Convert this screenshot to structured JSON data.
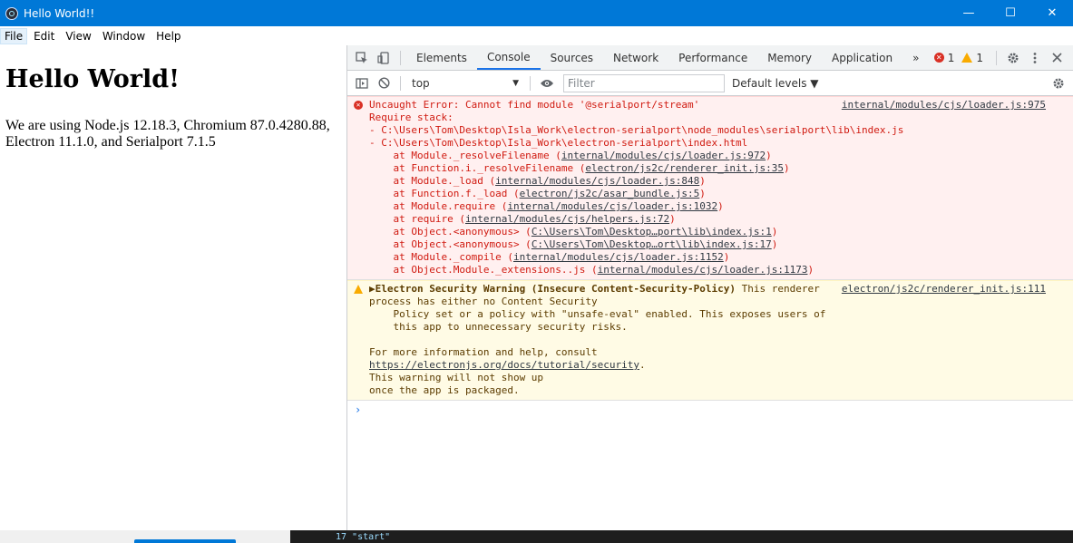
{
  "window": {
    "title": "Hello World!!",
    "controls": {
      "minimize": "—",
      "maximize": "☐",
      "close": "✕"
    },
    "accent": "#0078d7"
  },
  "menu": [
    "File",
    "Edit",
    "View",
    "Window",
    "Help"
  ],
  "page": {
    "heading": "Hello World!",
    "text": "We are using Node.js 12.18.3, Chromium 87.0.4280.88, Electron 11.1.0, and Serialport 7.1.5"
  },
  "devtools": {
    "tabs": [
      "Elements",
      "Console",
      "Sources",
      "Network",
      "Performance",
      "Memory",
      "Application"
    ],
    "selected_tab": "Console",
    "more_tabs": "»",
    "error_count": "1",
    "warning_count": "1",
    "toolbar": {
      "context": "top",
      "filter_placeholder": "Filter",
      "levels": "Default levels ▼"
    },
    "error": {
      "source": "internal/modules/cjs/loader.js:975",
      "lines": [
        "Uncaught Error: Cannot find module '@serialport/stream'",
        "Require stack:",
        "- C:\\Users\\Tom\\Desktop\\Isla_Work\\electron-serialport\\node_modules\\serialport\\lib\\index.js",
        "- C:\\Users\\Tom\\Desktop\\Isla_Work\\electron-serialport\\index.html"
      ],
      "stack": [
        {
          "fn": "    at Module._resolveFilename (",
          "loc": "internal/modules/cjs/loader.js:972"
        },
        {
          "fn": "    at Function.i._resolveFilename (",
          "loc": "electron/js2c/renderer_init.js:35"
        },
        {
          "fn": "    at Module._load (",
          "loc": "internal/modules/cjs/loader.js:848"
        },
        {
          "fn": "    at Function.f._load (",
          "loc": "electron/js2c/asar_bundle.js:5"
        },
        {
          "fn": "    at Module.require (",
          "loc": "internal/modules/cjs/loader.js:1032"
        },
        {
          "fn": "    at require (",
          "loc": "internal/modules/cjs/helpers.js:72"
        },
        {
          "fn": "    at Object.<anonymous> (",
          "loc": "C:\\Users\\Tom\\Desktop…port\\lib\\index.js:1"
        },
        {
          "fn": "    at Object.<anonymous> (",
          "loc": "C:\\Users\\Tom\\Desktop…ort\\lib\\index.js:17"
        },
        {
          "fn": "    at Module._compile (",
          "loc": "internal/modules/cjs/loader.js:1152"
        },
        {
          "fn": "    at Object.Module._extensions..js (",
          "loc": "internal/modules/cjs/loader.js:1173"
        }
      ]
    },
    "warning": {
      "source": "electron/js2c/renderer_init.js:111",
      "title": "▶Electron Security Warning (Insecure Content-Security-Policy)",
      "title_rest": " This renderer",
      "lines": [
        "process has either no Content Security",
        "    Policy set or a policy with \"unsafe-eval\" enabled. This exposes users of",
        "    this app to unnecessary security risks.",
        "",
        "For more information and help, consult"
      ],
      "link": "https://electronjs.org/docs/tutorial/security",
      "link_suffix": ".",
      "tail": [
        "This warning will not show up",
        "once the app is packaged."
      ]
    },
    "prompt": "›"
  },
  "taskbar_code": "17        \"start\""
}
